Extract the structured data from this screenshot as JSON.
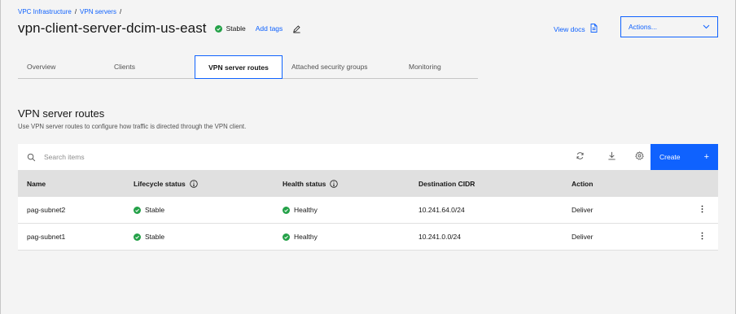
{
  "breadcrumb": {
    "items": [
      "VPC Infrastructure",
      "VPN servers"
    ],
    "separator": "/"
  },
  "header": {
    "title": "vpn-client-server-dcim-us-east",
    "status": "Stable",
    "add_tags": "Add tags",
    "view_docs": "View docs",
    "actions_label": "Actions..."
  },
  "tabs": [
    {
      "label": "Overview",
      "active": false
    },
    {
      "label": "Clients",
      "active": false
    },
    {
      "label": "VPN server routes",
      "active": true
    },
    {
      "label": "Attached security groups",
      "active": false
    },
    {
      "label": "Monitoring",
      "active": false
    }
  ],
  "section": {
    "title": "VPN server routes",
    "description": "Use VPN server routes to configure how traffic is directed through the VPN client."
  },
  "toolbar": {
    "search_placeholder": "Search items",
    "create_label": "Create",
    "create_icon": "+"
  },
  "table": {
    "headers": [
      "Name",
      "Lifecycle status",
      "Health status",
      "Destination CIDR",
      "Action"
    ],
    "rows": [
      {
        "name": "pag-subnet2",
        "lifecycle": "Stable",
        "health": "Healthy",
        "cidr": "10.241.64.0/24",
        "action": "Deliver"
      },
      {
        "name": "pag-subnet1",
        "lifecycle": "Stable",
        "health": "Healthy",
        "cidr": "10.241.0.0/24",
        "action": "Deliver"
      }
    ]
  },
  "colors": {
    "link": "#0f62fe",
    "success": "#24a148",
    "background": "#f4f4f4",
    "header_row": "#e0e0e0"
  }
}
